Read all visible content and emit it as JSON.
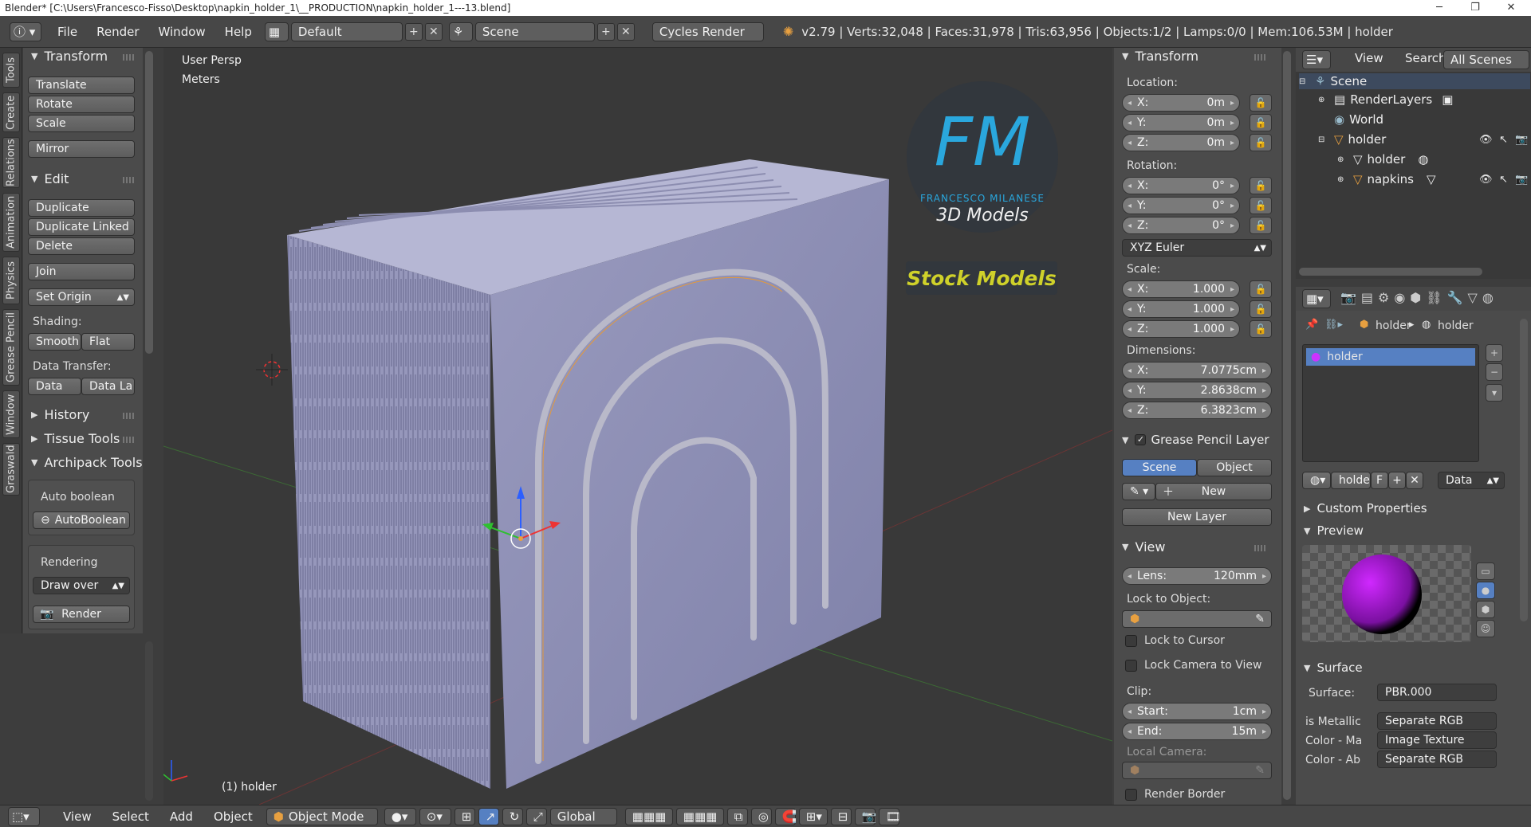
{
  "window": {
    "title": "Blender* [C:\\Users\\Francesco-Fisso\\Desktop\\napkin_holder_1\\__PRODUCTION\\napkin_holder_1---13.blend]"
  },
  "menu": [
    "File",
    "Render",
    "Window",
    "Help"
  ],
  "layout": "Default",
  "scene": "Scene",
  "engine": "Cycles Render",
  "stats": "v2.79 | Verts:32,048 | Faces:31,978 | Tris:63,956 | Objects:1/2 | Lamps:0/0 | Mem:106.53M | holder",
  "vtabs": [
    "Tools",
    "Create",
    "Relations",
    "Animation",
    "Physics",
    "Grease Pencil",
    "Window",
    "Graswald"
  ],
  "tools": {
    "transform": "Transform",
    "translate": "Translate",
    "rotate": "Rotate",
    "scale": "Scale",
    "mirror": "Mirror",
    "edit": "Edit",
    "duplicate": "Duplicate",
    "duplicate_linked": "Duplicate Linked",
    "delete": "Delete",
    "join": "Join",
    "set_origin": "Set Origin",
    "shading": "Shading:",
    "smooth": "Smooth",
    "flat": "Flat",
    "data_transfer": "Data Transfer:",
    "data": "Data",
    "data_la": "Data La",
    "history": "History",
    "tissue": "Tissue Tools",
    "archipack": "Archipack Tools",
    "auto_boolean": "Auto boolean",
    "autoboolean_btn": "AutoBoolean",
    "rendering": "Rendering",
    "draw_over": "Draw over",
    "render": "Render"
  },
  "viewport": {
    "persp": "User Persp",
    "units": "Meters",
    "active": "(1) holder",
    "logo_letters": "FM",
    "logo_name": "FRANCESCO MILANESE",
    "logo_sub": "3D Models",
    "stock": "Stock Models"
  },
  "npanel": {
    "transform": "Transform",
    "location": "Location:",
    "loc": [
      {
        "a": "X:",
        "v": "0m"
      },
      {
        "a": "Y:",
        "v": "0m"
      },
      {
        "a": "Z:",
        "v": "0m"
      }
    ],
    "rotation": "Rotation:",
    "rot": [
      {
        "a": "X:",
        "v": "0°"
      },
      {
        "a": "Y:",
        "v": "0°"
      },
      {
        "a": "Z:",
        "v": "0°"
      }
    ],
    "euler": "XYZ Euler",
    "scale": "Scale:",
    "scl": [
      {
        "a": "X:",
        "v": "1.000"
      },
      {
        "a": "Y:",
        "v": "1.000"
      },
      {
        "a": "Z:",
        "v": "1.000"
      }
    ],
    "dimensions": "Dimensions:",
    "dim": [
      {
        "a": "X:",
        "v": "7.0775cm"
      },
      {
        "a": "Y:",
        "v": "2.8638cm"
      },
      {
        "a": "Z:",
        "v": "6.3823cm"
      }
    ],
    "gp_layer": "Grease Pencil Layer",
    "gp_scene": "Scene",
    "gp_object": "Object",
    "gp_new": "New",
    "gp_newlayer": "New Layer",
    "view": "View",
    "lens_l": "Lens:",
    "lens_v": "120mm",
    "lock_obj": "Lock to Object:",
    "lock_cursor": "Lock to Cursor",
    "lock_cam": "Lock Camera to View",
    "clip": "Clip:",
    "start_l": "Start:",
    "start_v": "1cm",
    "end_l": "End:",
    "end_v": "15m",
    "local_cam": "Local Camera:",
    "render_border": "Render Border"
  },
  "outliner": {
    "view": "View",
    "search": "Search",
    "all_scenes": "All Scenes",
    "items": [
      "Scene",
      "RenderLayers",
      "World",
      "holder",
      "holder",
      "napkins"
    ]
  },
  "props": {
    "crumb_obj": "holder",
    "crumb_mat": "holder",
    "slot": "holder",
    "mat_name": "holde",
    "f": "F",
    "data": "Data",
    "custom": "Custom Properties",
    "preview": "Preview",
    "surface": "Surface",
    "surface_l": "Surface:",
    "surface_v": "PBR.000",
    "metal_l": "is Metallic",
    "metal_v": "Separate RGB",
    "colma_l": "Color - Ma",
    "colma_v": "Image Texture",
    "colab_l": "Color - Ab",
    "colab_v": "Separate RGB"
  },
  "bottom": {
    "view": "View",
    "select": "Select",
    "add": "Add",
    "object": "Object",
    "mode": "Object Mode",
    "orient": "Global"
  }
}
